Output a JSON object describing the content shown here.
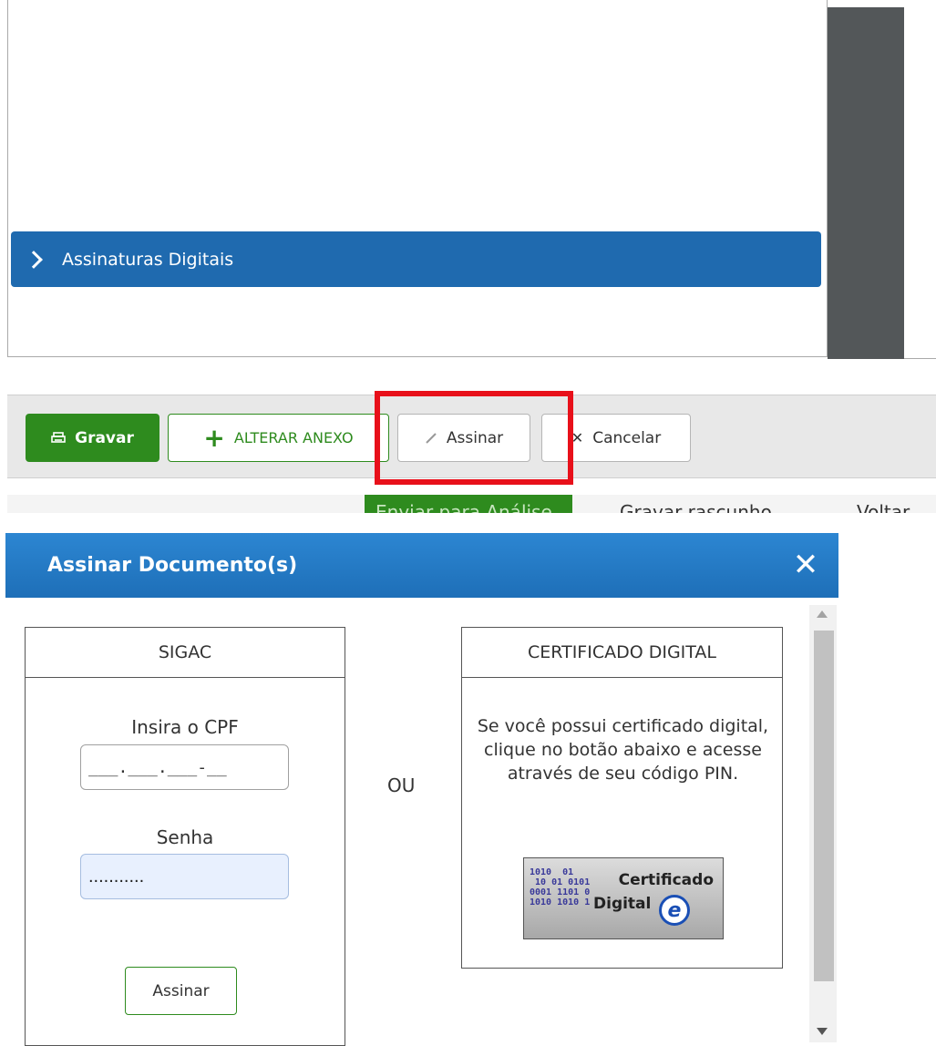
{
  "accordion": {
    "label": "Assinaturas Digitais"
  },
  "toolbar": {
    "save_label": "Gravar",
    "change_attachment_label": "ALTERAR ANEXO",
    "sign_label": "Assinar",
    "cancel_label": "Cancelar"
  },
  "cut_strip": {
    "send_label": "Enviar para Análise",
    "draft_label": "Gravar rascunho",
    "back_label": "Voltar"
  },
  "modal": {
    "title": "Assinar Documento(s)",
    "separator": "OU",
    "sigac": {
      "heading": "SIGAC",
      "cpf_label": "Insira o CPF",
      "cpf_value": "___.___.___-__",
      "password_label": "Senha",
      "password_value": "...........",
      "sign_button": "Assinar"
    },
    "certificate": {
      "heading": "CERTIFICADO DIGITAL",
      "description": "Se você possui certificado digital, clique no botão abaixo e acesse através de seu código PIN.",
      "button_text_line1": "Certificado",
      "button_text_line2": "Digital",
      "button_logo_letter": "e"
    }
  },
  "colors": {
    "accent_blue": "#1f6aaf",
    "green": "#2e8b1e",
    "highlight_red": "#e8101a"
  }
}
